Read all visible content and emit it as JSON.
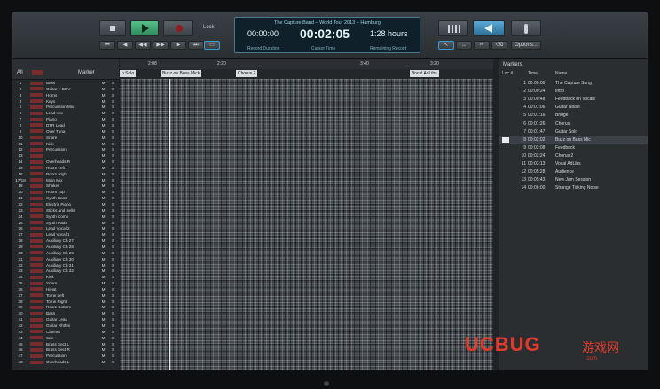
{
  "transport": {
    "lock_label": "Lock",
    "song_title": "The Capture Band – World Tour 2013 – Hamburg",
    "record_duration": "00:00:00",
    "record_duration_label": "Record Duration",
    "cursor_time": "00:02:05",
    "cursor_time_label": "Cursor Time",
    "remaining": "1:28 hours",
    "remaining_label": "Remaining Record",
    "options_label": "Options..."
  },
  "tracks": {
    "all_label": "All",
    "header_label": "Marker",
    "items": [
      {
        "n": "1",
        "name": "Bass"
      },
      {
        "n": "2",
        "name": "Guitar + BGV"
      },
      {
        "n": "3",
        "name": "Horns"
      },
      {
        "n": "4",
        "name": "Keys"
      },
      {
        "n": "5",
        "name": "Percussion Mix"
      },
      {
        "n": "6",
        "name": "Lead Vox"
      },
      {
        "n": "7",
        "name": "Piano"
      },
      {
        "n": "8",
        "name": "DTR Lead"
      },
      {
        "n": "9",
        "name": "Over Tuna"
      },
      {
        "n": "10",
        "name": "Snare"
      },
      {
        "n": "11",
        "name": "Kick"
      },
      {
        "n": "12",
        "name": "Percussion"
      },
      {
        "n": "13",
        "name": ""
      },
      {
        "n": "14",
        "name": "Overheads R"
      },
      {
        "n": "15",
        "name": "Room Left"
      },
      {
        "n": "16",
        "name": "Room Right"
      },
      {
        "n": "17/18",
        "name": "Main Mix"
      },
      {
        "n": "19",
        "name": "Shaker"
      },
      {
        "n": "20",
        "name": "Room Top"
      },
      {
        "n": "21",
        "name": "Synth Bass"
      },
      {
        "n": "22",
        "name": "Electric Piano"
      },
      {
        "n": "23",
        "name": "Sticks and Bells"
      },
      {
        "n": "24",
        "name": "Synth Comp"
      },
      {
        "n": "25",
        "name": "Synth Pads"
      },
      {
        "n": "26",
        "name": "Lead Vocal 2"
      },
      {
        "n": "27",
        "name": "Lead Vocal 1"
      },
      {
        "n": "28",
        "name": "Auxiliary Ch 27"
      },
      {
        "n": "29",
        "name": "Auxiliary Ch 28"
      },
      {
        "n": "30",
        "name": "Auxiliary Ch 29"
      },
      {
        "n": "31",
        "name": "Auxiliary Ch 30"
      },
      {
        "n": "32",
        "name": "Auxiliary Ch 31"
      },
      {
        "n": "33",
        "name": "Auxiliary Ch 32"
      },
      {
        "n": "34",
        "name": "Kick"
      },
      {
        "n": "35",
        "name": "Snare"
      },
      {
        "n": "36",
        "name": "HiHat"
      },
      {
        "n": "37",
        "name": "Tome Left"
      },
      {
        "n": "38",
        "name": "Tome Right"
      },
      {
        "n": "39",
        "name": "Room Bottom"
      },
      {
        "n": "40",
        "name": "Bass"
      },
      {
        "n": "41",
        "name": "Guitar Lead"
      },
      {
        "n": "42",
        "name": "Guitar Rhthm"
      },
      {
        "n": "43",
        "name": "Clarinet"
      },
      {
        "n": "44",
        "name": "Sax"
      },
      {
        "n": "45",
        "name": "Brass Sect L"
      },
      {
        "n": "46",
        "name": "Brass Sect R"
      },
      {
        "n": "47",
        "name": "Percussion"
      },
      {
        "n": "48",
        "name": "Overheads L"
      }
    ],
    "mute_label": "M",
    "solo_label": "S"
  },
  "ruler": [
    "2:08",
    "2:20",
    "3:40",
    "3:20"
  ],
  "timeline_markers": [
    {
      "label": "o Solo"
    },
    {
      "label": "Buzz on Bass Mick"
    },
    {
      "label": "Chorus 2"
    },
    {
      "label": "Vocal AdLibs"
    }
  ],
  "markers_panel": {
    "title": "Markers",
    "col_loc": "Loc #",
    "col_time": "Time",
    "col_name": "Name",
    "rows": [
      {
        "no": "1",
        "time": "00:00:00",
        "name": "The Capture Song"
      },
      {
        "no": "2",
        "time": "00:00:24",
        "name": "Intro"
      },
      {
        "no": "3",
        "time": "00:00:48",
        "name": "Feedback on Vocals"
      },
      {
        "no": "4",
        "time": "00:01:06",
        "name": "Guitar Noise"
      },
      {
        "no": "5",
        "time": "00:01:16",
        "name": "Bridge"
      },
      {
        "no": "6",
        "time": "00:01:26",
        "name": "Chorus"
      },
      {
        "no": "7",
        "time": "00:01:47",
        "name": "Guitar Solo"
      },
      {
        "no": "8",
        "time": "00:02:02",
        "name": "Buzz on Bass Mic"
      },
      {
        "no": "9",
        "time": "00:02:08",
        "name": "Feedback"
      },
      {
        "no": "10",
        "time": "00:02:24",
        "name": "Chorus 2"
      },
      {
        "no": "11",
        "time": "00:03:13",
        "name": "Vocal AdLibs"
      },
      {
        "no": "12",
        "time": "00:05:28",
        "name": "Audience"
      },
      {
        "no": "13",
        "time": "00:05:43",
        "name": "New Jam Session"
      },
      {
        "no": "14",
        "time": "00:06:00",
        "name": "Strange Ticking Noise"
      }
    ]
  },
  "watermark": {
    "brand": "UCBUG",
    "cn": "游戏网",
    "site": ".com"
  }
}
